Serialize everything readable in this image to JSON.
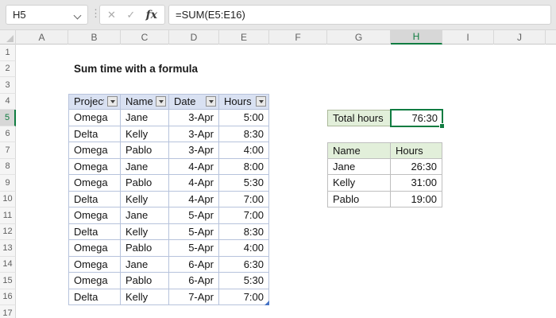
{
  "formula_bar": {
    "name_box_value": "H5",
    "formula": "=SUM(E5:E16)"
  },
  "icons": {
    "cancel": "✕",
    "enter": "✓",
    "fx": "fx",
    "dots": "⋮"
  },
  "sheet": {
    "title": "Sum time with a formula",
    "column_letters": [
      "A",
      "B",
      "C",
      "D",
      "E",
      "F",
      "G",
      "H",
      "I",
      "J",
      ""
    ],
    "row_numbers": [
      "1",
      "2",
      "3",
      "4",
      "5",
      "6",
      "7",
      "8",
      "9",
      "10",
      "11",
      "12",
      "13",
      "14",
      "15",
      "16",
      "17"
    ],
    "selected_column": "H",
    "selected_row": "5",
    "selected_cell": "H5"
  },
  "main_table": {
    "headers": [
      "Project",
      "Name",
      "Date",
      "Hours"
    ],
    "rows": [
      [
        "Omega",
        "Jane",
        "3-Apr",
        "5:00"
      ],
      [
        "Delta",
        "Kelly",
        "3-Apr",
        "8:30"
      ],
      [
        "Omega",
        "Pablo",
        "3-Apr",
        "4:00"
      ],
      [
        "Omega",
        "Jane",
        "4-Apr",
        "8:00"
      ],
      [
        "Omega",
        "Pablo",
        "4-Apr",
        "5:30"
      ],
      [
        "Delta",
        "Kelly",
        "4-Apr",
        "7:00"
      ],
      [
        "Omega",
        "Jane",
        "5-Apr",
        "7:00"
      ],
      [
        "Delta",
        "Kelly",
        "5-Apr",
        "8:30"
      ],
      [
        "Omega",
        "Pablo",
        "5-Apr",
        "4:00"
      ],
      [
        "Omega",
        "Jane",
        "6-Apr",
        "6:30"
      ],
      [
        "Omega",
        "Pablo",
        "6-Apr",
        "5:30"
      ],
      [
        "Delta",
        "Kelly",
        "7-Apr",
        "7:00"
      ]
    ]
  },
  "total": {
    "label": "Total hours",
    "value": "76:30"
  },
  "summary_table": {
    "headers": [
      "Name",
      "Hours"
    ],
    "rows": [
      [
        "Jane",
        "26:30"
      ],
      [
        "Kelly",
        "31:00"
      ],
      [
        "Pablo",
        "19:00"
      ]
    ]
  },
  "colors": {
    "accent_green": "#107C41",
    "header_blue_fill": "#D9E1F2",
    "table_border_blue": "#B7C3DC",
    "summary_green_fill": "#E2EFDA",
    "summary_border_gray": "#BFBFBF",
    "resize_handle_blue": "#4472C4"
  }
}
